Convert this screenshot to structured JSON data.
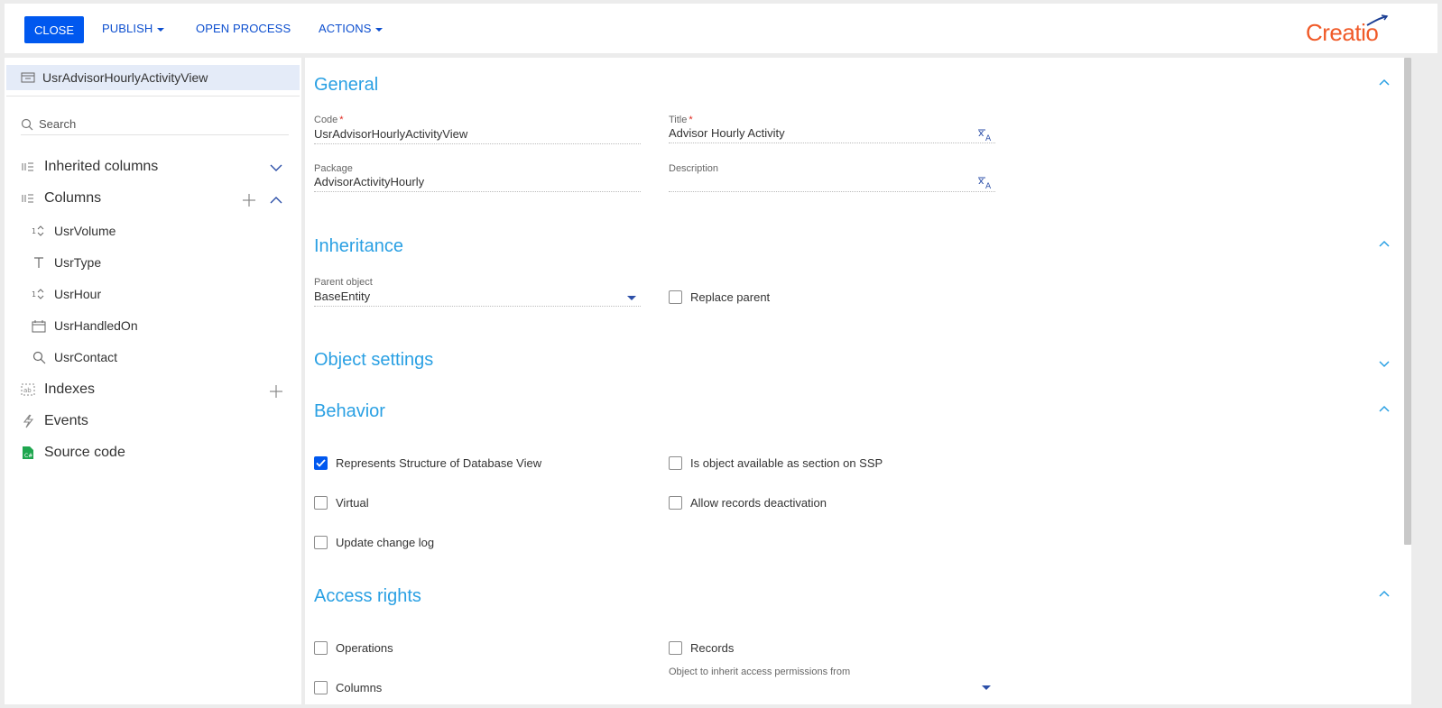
{
  "toolbar": {
    "close_label": "CLOSE",
    "publish_label": "PUBLISH",
    "open_process_label": "OPEN PROCESS",
    "actions_label": "ACTIONS",
    "logo_text": "Creatio"
  },
  "sidebar": {
    "object_name": "UsrAdvisorHourlyActivityView",
    "search_placeholder": "Search",
    "inherited_columns_label": "Inherited columns",
    "columns_label": "Columns",
    "columns": [
      {
        "label": "UsrVolume",
        "icon": "integer-icon"
      },
      {
        "label": "UsrType",
        "icon": "text-icon"
      },
      {
        "label": "UsrHour",
        "icon": "integer-icon"
      },
      {
        "label": "UsrHandledOn",
        "icon": "calendar-icon"
      },
      {
        "label": "UsrContact",
        "icon": "lookup-icon"
      }
    ],
    "indexes_label": "Indexes",
    "events_label": "Events",
    "source_code_label": "Source code"
  },
  "general": {
    "title": "General",
    "code_label": "Code",
    "code_value": "UsrAdvisorHourlyActivityView",
    "title_label": "Title",
    "title_value": "Advisor Hourly Activity",
    "package_label": "Package",
    "package_value": "AdvisorActivityHourly",
    "description_label": "Description",
    "description_value": ""
  },
  "inheritance": {
    "title": "Inheritance",
    "parent_label": "Parent object",
    "parent_value": "BaseEntity",
    "replace_parent_label": "Replace parent",
    "replace_parent_checked": false
  },
  "object_settings": {
    "title": "Object settings"
  },
  "behavior": {
    "title": "Behavior",
    "represents_view_label": "Represents Structure of Database View",
    "represents_view_checked": true,
    "ssp_label": "Is object available as section on SSP",
    "ssp_checked": false,
    "virtual_label": "Virtual",
    "virtual_checked": false,
    "deactivation_label": "Allow records deactivation",
    "deactivation_checked": false,
    "change_log_label": "Update change log",
    "change_log_checked": false
  },
  "access_rights": {
    "title": "Access rights",
    "operations_label": "Operations",
    "operations_checked": false,
    "records_label": "Records",
    "records_checked": false,
    "columns_label": "Columns",
    "columns_checked": false,
    "inherit_from_label": "Object to inherit access permissions from"
  },
  "colors": {
    "accent": "#0058ef",
    "section_title": "#2aa0e3",
    "logo": "#f05a28",
    "selected_bg": "#e4ebf8"
  }
}
